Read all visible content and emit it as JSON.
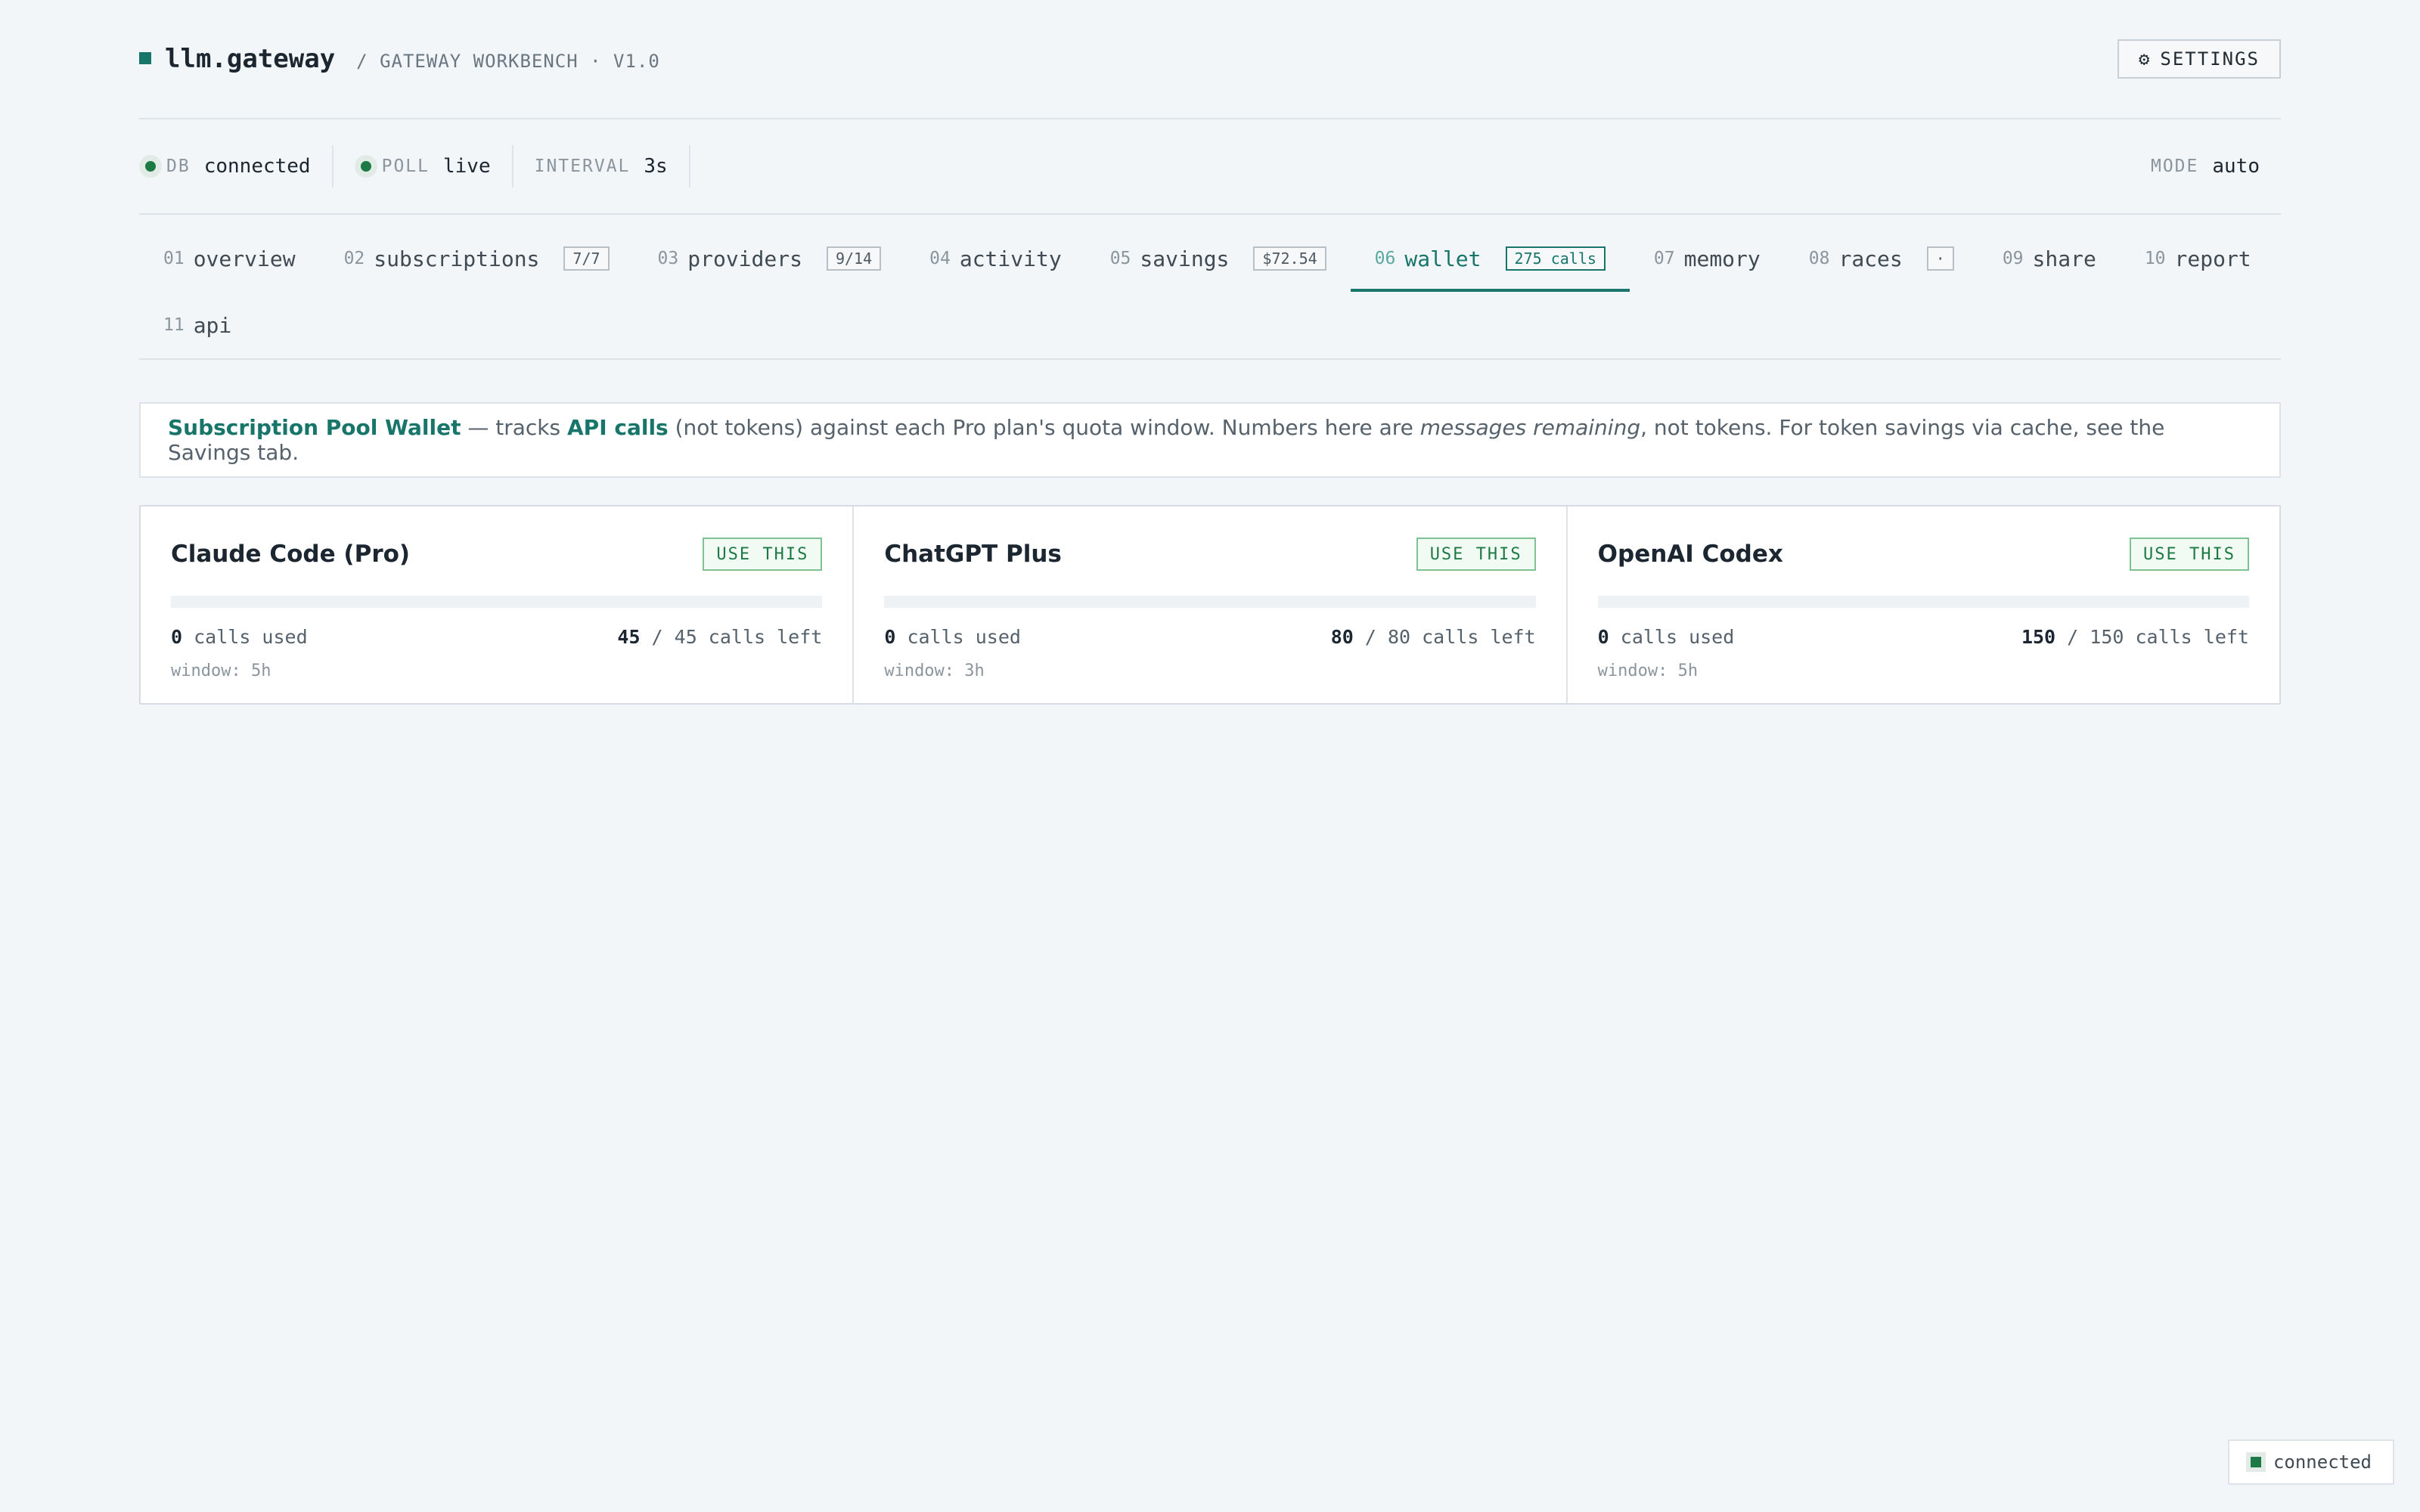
{
  "header": {
    "app_name": "llm.gateway",
    "subtitle": "/ GATEWAY WORKBENCH · V1.0",
    "settings_icon": "⚙",
    "settings_label": "SETTINGS"
  },
  "status": {
    "db": {
      "label": "DB",
      "value": "connected"
    },
    "poll": {
      "label": "POLL",
      "value": "live"
    },
    "interval": {
      "label": "INTERVAL",
      "value": "3s"
    },
    "mode": {
      "label": "MODE",
      "value": "auto"
    },
    "status_color": "#1e7a45"
  },
  "tabs": [
    {
      "num": "01",
      "label": "overview",
      "badge": ""
    },
    {
      "num": "02",
      "label": "subscriptions",
      "badge": "7/7"
    },
    {
      "num": "03",
      "label": "providers",
      "badge": "9/14"
    },
    {
      "num": "04",
      "label": "activity",
      "badge": ""
    },
    {
      "num": "05",
      "label": "savings",
      "badge": "$72.54"
    },
    {
      "num": "06",
      "label": "wallet",
      "badge": "275 calls",
      "active": true
    },
    {
      "num": "07",
      "label": "memory",
      "badge": ""
    },
    {
      "num": "08",
      "label": "races",
      "badge": "·"
    },
    {
      "num": "09",
      "label": "share",
      "badge": ""
    },
    {
      "num": "10",
      "label": "report",
      "badge": ""
    },
    {
      "num": "11",
      "label": "api",
      "badge": ""
    }
  ],
  "info": {
    "title": "Subscription Pool Wallet",
    "t1": " — tracks ",
    "api_calls": "API calls",
    "t2": " (not tokens) against each Pro plan's quota window. Numbers here are ",
    "em": "messages remaining",
    "t3": ", not tokens. For token savings via cache, see the Savings tab."
  },
  "wallet": [
    {
      "name": "Claude Code (Pro)",
      "button": "USE THIS",
      "used": "0",
      "used_suffix": " calls used",
      "left": "45",
      "left_suffix": " / 45 calls left",
      "window": "window: 5h",
      "used_fraction": 0
    },
    {
      "name": "ChatGPT Plus",
      "button": "USE THIS",
      "used": "0",
      "used_suffix": " calls used",
      "left": "80",
      "left_suffix": " / 80 calls left",
      "window": "window: 3h",
      "used_fraction": 0
    },
    {
      "name": "OpenAI Codex",
      "button": "USE THIS",
      "used": "0",
      "used_suffix": " calls used",
      "left": "150",
      "left_suffix": " / 150 calls left",
      "window": "window: 5h",
      "used_fraction": 0
    }
  ],
  "toast": {
    "label": "connected"
  },
  "colors": {
    "accent": "#17756a",
    "success": "#1e7a45",
    "background": "#f3f6f9"
  }
}
